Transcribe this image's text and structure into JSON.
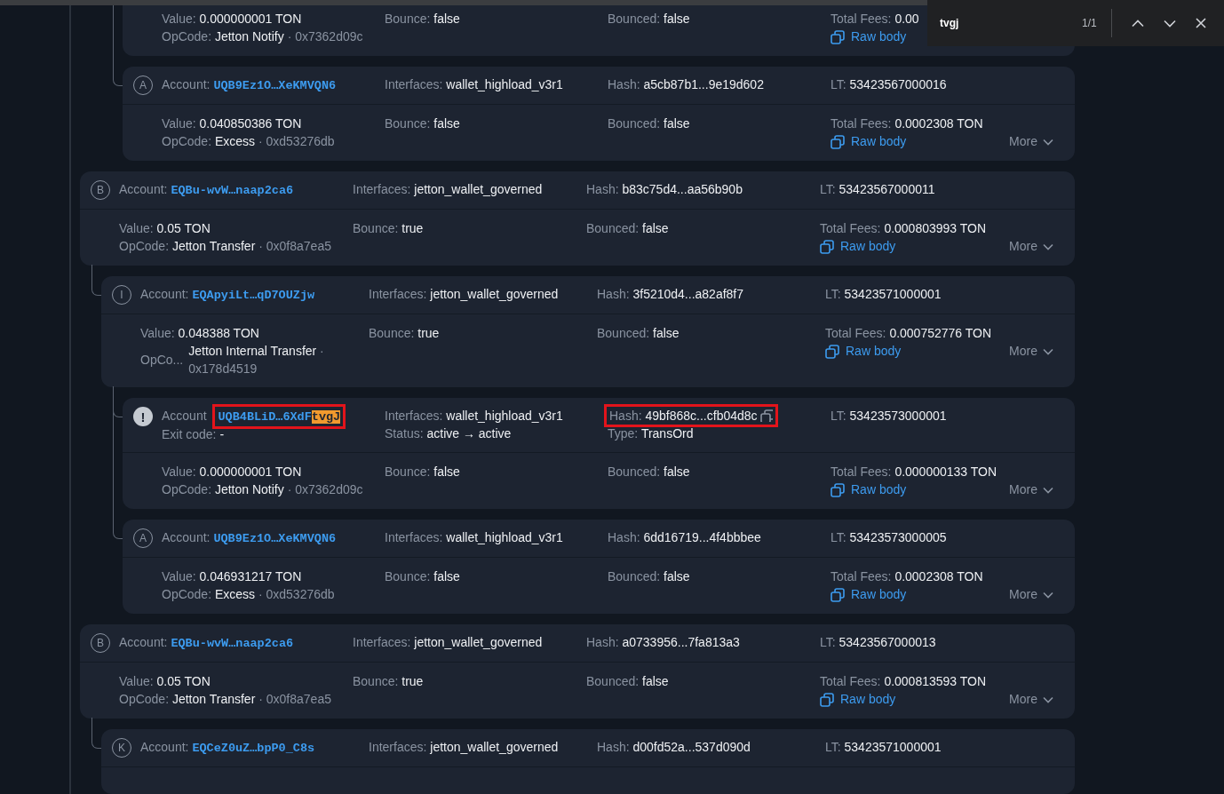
{
  "find_bar": {
    "query": "tvgj",
    "count": "1/1"
  },
  "messages": [
    {
      "children": [
        {
          "children": [
            {
              "body": [
                [
                  {
                    "label": "Value:",
                    "value": "0.000000001 TON"
                  },
                  {
                    "label": "OpCode:",
                    "value": "Jetton Notify",
                    "sep": "·",
                    "hex": "0x7362d09c"
                  }
                ],
                [
                  {
                    "label": "Bounce:",
                    "value": "false"
                  }
                ],
                [
                  {
                    "label": "Bounced:",
                    "value": "false"
                  }
                ],
                [
                  {
                    "label": "Total Fees:",
                    "value": "0.00"
                  },
                  {
                    "kind": "raw",
                    "value": "Raw body"
                  }
                ]
              ]
            },
            {
              "icon": {
                "kind": "letter",
                "text": "A"
              },
              "header": [
                [
                  {
                    "label": "Account:",
                    "value": "UQB9Ez1O…XeKMVQN6",
                    "kind": "address"
                  }
                ],
                [
                  {
                    "label": "Interfaces:",
                    "value": "wallet_highload_v3r1"
                  }
                ],
                [
                  {
                    "label": "Hash:",
                    "value": "a5cb87b1...9e19d602"
                  }
                ],
                [
                  {
                    "label": "LT:",
                    "value": "53423567000016"
                  }
                ]
              ],
              "body": [
                [
                  {
                    "label": "Value:",
                    "value": "0.040850386 TON"
                  },
                  {
                    "label": "OpCode:",
                    "value": "Excess",
                    "sep": "·",
                    "hex": "0xd53276db"
                  }
                ],
                [
                  {
                    "label": "Bounce:",
                    "value": "false"
                  }
                ],
                [
                  {
                    "label": "Bounced:",
                    "value": "false"
                  }
                ],
                [
                  {
                    "label": "Total Fees:",
                    "value": "0.0002308 TON"
                  },
                  {
                    "kind": "raw",
                    "value": "Raw body"
                  }
                ]
              ],
              "more": "More"
            }
          ]
        }
      ]
    },
    {
      "icon": {
        "kind": "letter",
        "text": "B"
      },
      "header": [
        [
          {
            "label": "Account:",
            "value": "EQBu-wvW…naap2ca6",
            "kind": "address"
          }
        ],
        [
          {
            "label": "Interfaces:",
            "value": "jetton_wallet_governed"
          }
        ],
        [
          {
            "label": "Hash:",
            "value": "b83c75d4...aa56b90b"
          }
        ],
        [
          {
            "label": "LT:",
            "value": "53423567000011"
          }
        ]
      ],
      "body": [
        [
          {
            "label": "Value:",
            "value": "0.05 TON"
          },
          {
            "label": "OpCode:",
            "value": "Jetton Transfer",
            "sep": "·",
            "hex": "0x0f8a7ea5"
          }
        ],
        [
          {
            "label": "Bounce:",
            "value": "true"
          }
        ],
        [
          {
            "label": "Bounced:",
            "value": "false"
          }
        ],
        [
          {
            "label": "Total Fees:",
            "value": "0.000803993 TON"
          },
          {
            "kind": "raw",
            "value": "Raw body"
          }
        ]
      ],
      "more": "More",
      "children": [
        {
          "icon": {
            "kind": "letter",
            "text": "I"
          },
          "header": [
            [
              {
                "label": "Account:",
                "value": "EQApyiLt…qD7OUZjw",
                "kind": "address"
              }
            ],
            [
              {
                "label": "Interfaces:",
                "value": "jetton_wallet_governed"
              }
            ],
            [
              {
                "label": "Hash:",
                "value": "3f5210d4...a82af8f7"
              }
            ],
            [
              {
                "label": "LT:",
                "value": "53423571000001"
              }
            ]
          ],
          "body": [
            [
              {
                "label": "Value:",
                "value": "0.048388 TON"
              },
              {
                "label": "OpCo...",
                "value": "Jetton Internal Transfer",
                "sep": "·",
                "hex": "0x178d4519",
                "wrapped": true
              }
            ],
            [
              {
                "label": "Bounce:",
                "value": "true"
              }
            ],
            [
              {
                "label": "Bounced:",
                "value": "false"
              }
            ],
            [
              {
                "label": "Total Fees:",
                "value": "0.000752776 TON"
              },
              {
                "kind": "raw",
                "value": "Raw body"
              }
            ]
          ],
          "more": "More",
          "children": [
            {
              "icon": {
                "kind": "alert",
                "text": "!"
              },
              "header": [
                [
                  {
                    "label": "Account",
                    "value": "UQB4BLiD…6XdF",
                    "highlight": "tvgJ",
                    "kind": "address",
                    "outlined": true
                  },
                  {
                    "label": "Exit code:",
                    "value": "-"
                  }
                ],
                [
                  {
                    "label": "Interfaces:",
                    "value": "wallet_highload_v3r1"
                  },
                  {
                    "label": "Status:",
                    "value": "active → active"
                  }
                ],
                [
                  {
                    "label": "Hash:",
                    "value": "49bf868c...cfb04d8c",
                    "copy": true,
                    "outlined": true
                  },
                  {
                    "label": "Type:",
                    "value": "TransOrd"
                  }
                ],
                [
                  {
                    "label": "LT:",
                    "value": "53423573000001"
                  }
                ]
              ],
              "body": [
                [
                  {
                    "label": "Value:",
                    "value": "0.000000001 TON"
                  },
                  {
                    "label": "OpCode:",
                    "value": "Jetton Notify",
                    "sep": "·",
                    "hex": "0x7362d09c"
                  }
                ],
                [
                  {
                    "label": "Bounce:",
                    "value": "false"
                  }
                ],
                [
                  {
                    "label": "Bounced:",
                    "value": "false"
                  }
                ],
                [
                  {
                    "label": "Total Fees:",
                    "value": "0.000000133 TON"
                  },
                  {
                    "kind": "raw",
                    "value": "Raw body"
                  }
                ]
              ],
              "more": "More"
            },
            {
              "icon": {
                "kind": "letter",
                "text": "A"
              },
              "header": [
                [
                  {
                    "label": "Account:",
                    "value": "UQB9Ez1O…XeKMVQN6",
                    "kind": "address"
                  }
                ],
                [
                  {
                    "label": "Interfaces:",
                    "value": "wallet_highload_v3r1"
                  }
                ],
                [
                  {
                    "label": "Hash:",
                    "value": "6dd16719...4f4bbbee"
                  }
                ],
                [
                  {
                    "label": "LT:",
                    "value": "53423573000005"
                  }
                ]
              ],
              "body": [
                [
                  {
                    "label": "Value:",
                    "value": "0.046931217 TON"
                  },
                  {
                    "label": "OpCode:",
                    "value": "Excess",
                    "sep": "·",
                    "hex": "0xd53276db"
                  }
                ],
                [
                  {
                    "label": "Bounce:",
                    "value": "false"
                  }
                ],
                [
                  {
                    "label": "Bounced:",
                    "value": "false"
                  }
                ],
                [
                  {
                    "label": "Total Fees:",
                    "value": "0.0002308 TON"
                  },
                  {
                    "kind": "raw",
                    "value": "Raw body"
                  }
                ]
              ],
              "more": "More"
            }
          ]
        }
      ]
    },
    {
      "icon": {
        "kind": "letter",
        "text": "B"
      },
      "header": [
        [
          {
            "label": "Account:",
            "value": "EQBu-wvW…naap2ca6",
            "kind": "address"
          }
        ],
        [
          {
            "label": "Interfaces:",
            "value": "jetton_wallet_governed"
          }
        ],
        [
          {
            "label": "Hash:",
            "value": "a0733956...7fa813a3"
          }
        ],
        [
          {
            "label": "LT:",
            "value": "53423567000013"
          }
        ]
      ],
      "body": [
        [
          {
            "label": "Value:",
            "value": "0.05 TON"
          },
          {
            "label": "OpCode:",
            "value": "Jetton Transfer",
            "sep": "·",
            "hex": "0x0f8a7ea5"
          }
        ],
        [
          {
            "label": "Bounce:",
            "value": "true"
          }
        ],
        [
          {
            "label": "Bounced:",
            "value": "false"
          }
        ],
        [
          {
            "label": "Total Fees:",
            "value": "0.000813593 TON"
          },
          {
            "kind": "raw",
            "value": "Raw body"
          }
        ]
      ],
      "more": "More",
      "children": [
        {
          "icon": {
            "kind": "letter",
            "text": "K"
          },
          "header": [
            [
              {
                "label": "Account:",
                "value": "EQCeZ0uZ…bpP0_C8s",
                "kind": "address"
              }
            ],
            [
              {
                "label": "Interfaces:",
                "value": "jetton_wallet_governed"
              }
            ],
            [
              {
                "label": "Hash:",
                "value": "d00fd52a...537d090d"
              }
            ],
            [
              {
                "label": "LT:",
                "value": "53423571000001"
              }
            ]
          ]
        }
      ]
    }
  ]
}
